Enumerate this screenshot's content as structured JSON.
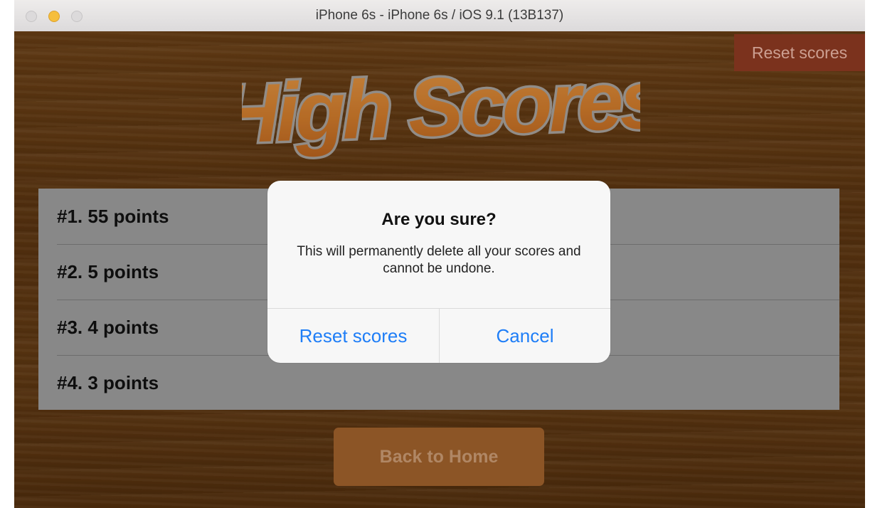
{
  "window": {
    "title": "iPhone 6s - iPhone 6s / iOS 9.1 (13B137)"
  },
  "header": {
    "logo_text": "High Scores",
    "reset_label": "Reset scores"
  },
  "scores": [
    {
      "label": "#1. 55 points"
    },
    {
      "label": "#2. 5 points"
    },
    {
      "label": "#3. 4 points"
    },
    {
      "label": "#4. 3 points"
    }
  ],
  "footer": {
    "back_label": "Back to Home"
  },
  "alert": {
    "title": "Are you sure?",
    "message": "This will permanently delete all your scores and cannot be undone.",
    "confirm_label": "Reset scores",
    "cancel_label": "Cancel"
  },
  "colors": {
    "background_wood": "#5c3510",
    "accent_orange": "#cf7b2c",
    "reset_red": "#8c3a22",
    "ios_blue": "#1f7ef7"
  }
}
